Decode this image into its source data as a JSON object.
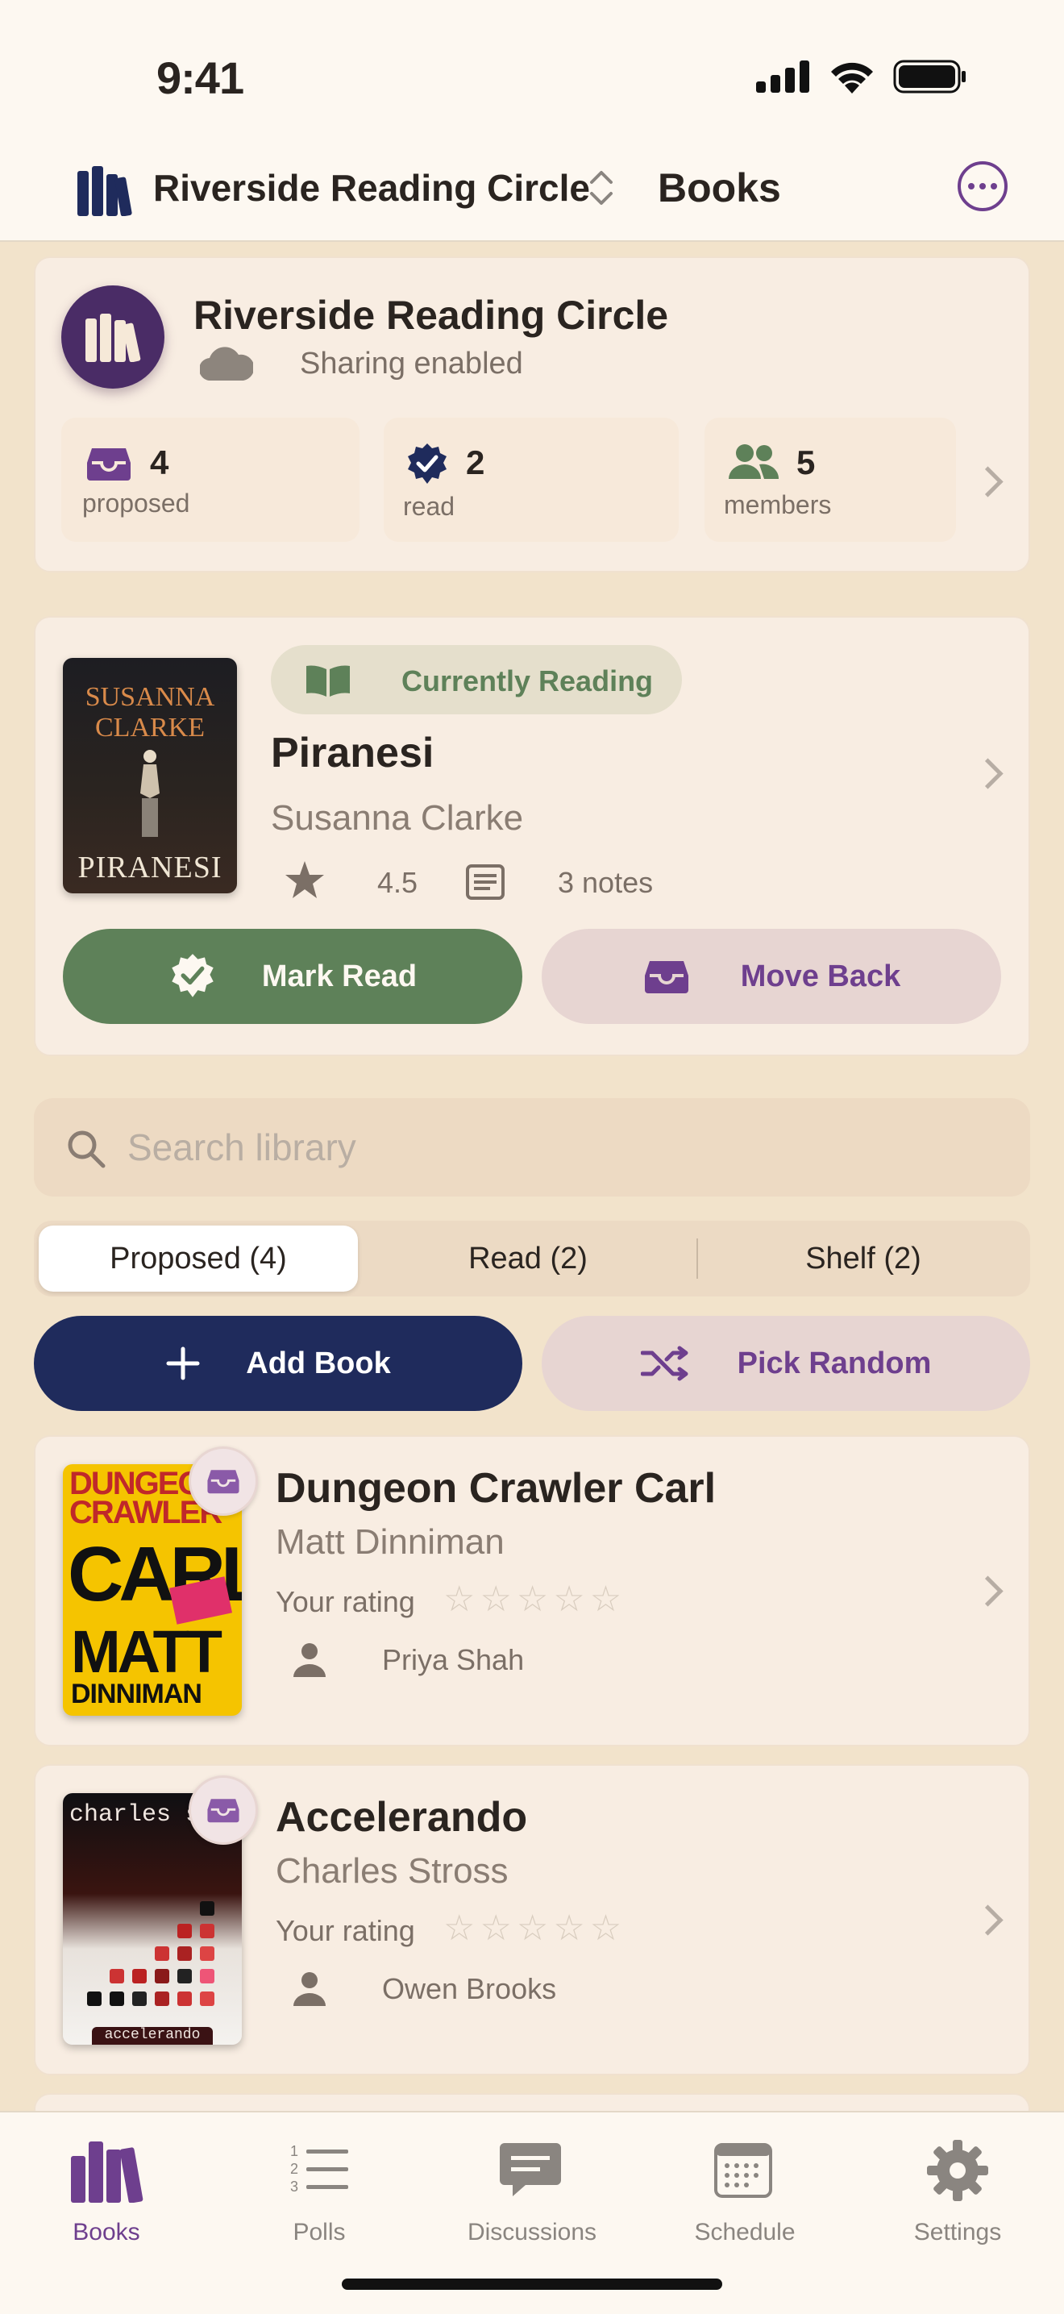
{
  "status": {
    "time": "9:41"
  },
  "header": {
    "group_name": "Riverside Reading Circle",
    "title": "Books"
  },
  "group_card": {
    "name": "Riverside Reading Circle",
    "sharing": "Sharing enabled",
    "stats": [
      {
        "number": "4",
        "label": "proposed"
      },
      {
        "number": "2",
        "label": "read"
      },
      {
        "number": "5",
        "label": "members"
      }
    ]
  },
  "current": {
    "badge": "Currently Reading",
    "title": "Piranesi",
    "author": "Susanna Clarke",
    "rating": "4.5",
    "notes": "3 notes",
    "cover_top": "Susanna Clarke",
    "cover_bottom": "Piranesi",
    "mark_read": "Mark Read",
    "move_back": "Move Back"
  },
  "search": {
    "placeholder": "Search library"
  },
  "segments": [
    "Proposed (4)",
    "Read (2)",
    "Shelf (2)"
  ],
  "actions": {
    "add_book": "Add Book",
    "pick_random": "Pick Random"
  },
  "books": [
    {
      "title": "Dungeon Crawler Carl",
      "author": "Matt Dinniman",
      "rating_label": "Your rating",
      "stars": "☆☆☆☆☆",
      "proposer": "Priya Shah",
      "cover_line1": "DUNGEON",
      "cover_line2": "CRAWLER",
      "cover_line3": "CARL",
      "cover_line4": "MATT",
      "cover_line5": "DINNIMAN"
    },
    {
      "title": "Accelerando",
      "author": "Charles Stross",
      "rating_label": "Your rating",
      "stars": "☆☆☆☆☆",
      "proposer": "Owen Brooks",
      "cover_top": "charles stross",
      "cover_bottom": "accelerando"
    }
  ],
  "tabs": [
    {
      "label": "Books",
      "active": true
    },
    {
      "label": "Polls",
      "active": false
    },
    {
      "label": "Discussions",
      "active": false
    },
    {
      "label": "Schedule",
      "active": false
    },
    {
      "label": "Settings",
      "active": false
    }
  ],
  "colors": {
    "accent_purple": "#6e3f8e",
    "accent_green": "#5e8159",
    "navy": "#1f2b5c",
    "background": "#f2e3cb"
  }
}
